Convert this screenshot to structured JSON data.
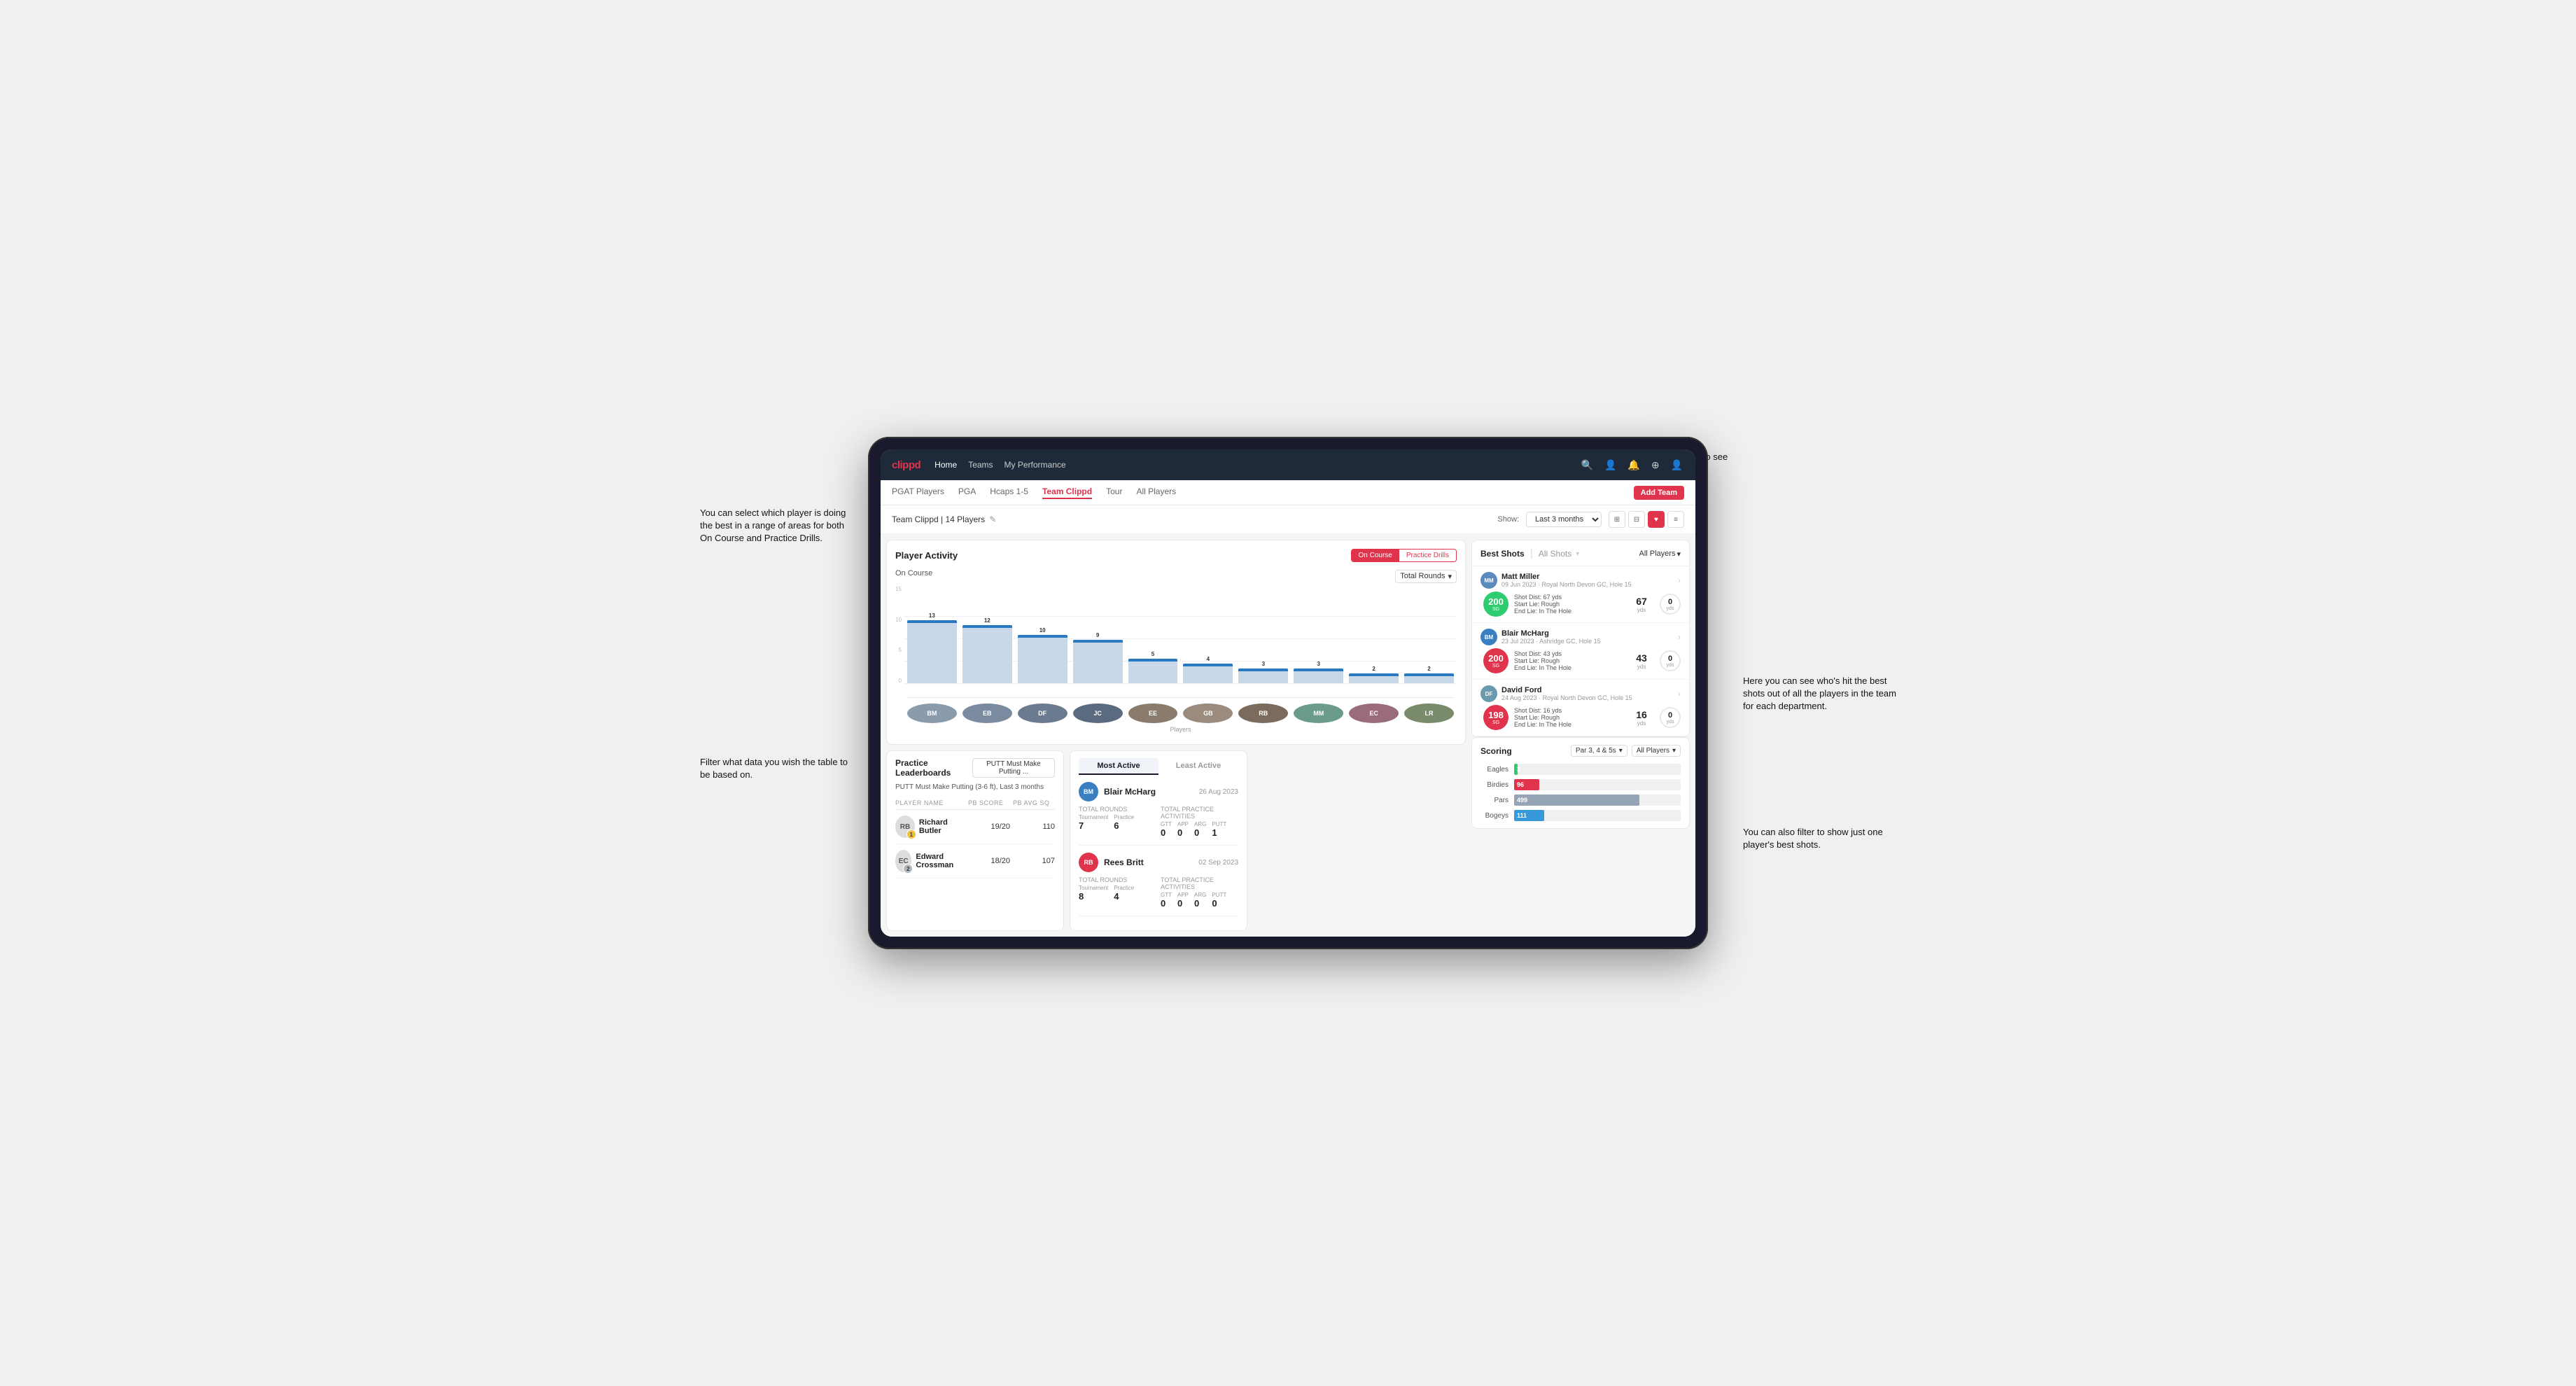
{
  "annotations": {
    "top_right": "Choose the timescale you wish to see the data over.",
    "top_left": "You can select which player is doing the best in a range of areas for both On Course and Practice Drills.",
    "bottom_left": "Filter what data you wish the table to be based on.",
    "middle_right": "Here you can see who's hit the best shots out of all the players in the team for each department.",
    "bottom_right": "You can also filter to show just one player's best shots."
  },
  "nav": {
    "logo": "clippd",
    "links": [
      "Home",
      "Teams",
      "My Performance"
    ],
    "icons": [
      "🔍",
      "👤",
      "🔔",
      "⊕",
      "👤"
    ]
  },
  "sub_nav": {
    "tabs": [
      "PGAT Players",
      "PGA",
      "Hcaps 1-5",
      "Team Clippd",
      "Tour",
      "All Players"
    ],
    "active_tab": "Team Clippd",
    "add_button": "Add Team"
  },
  "team_header": {
    "title": "Team Clippd | 14 Players",
    "edit_icon": "✎",
    "show_label": "Show:",
    "time_select": "Last 3 months",
    "view_modes": [
      "⊞",
      "⊟",
      "♥",
      "≡"
    ]
  },
  "player_activity": {
    "title": "Player Activity",
    "tabs": [
      "On Course",
      "Practice Drills"
    ],
    "active_tab": "On Course",
    "section": "On Course",
    "filter_label": "Total Rounds",
    "x_axis_label": "Players",
    "y_axis_label": "Total Rounds",
    "bars": [
      {
        "name": "B. McHarg",
        "value": 13,
        "color": "#c8d8e8"
      },
      {
        "name": "E. Britt",
        "value": 12,
        "color": "#c8d8e8"
      },
      {
        "name": "D. Ford",
        "value": 10,
        "color": "#c8d8e8"
      },
      {
        "name": "J. Coles",
        "value": 9,
        "color": "#c8d8e8"
      },
      {
        "name": "E. Ebert",
        "value": 5,
        "color": "#c8d8e8"
      },
      {
        "name": "G. Billingham",
        "value": 4,
        "color": "#c8d8e8"
      },
      {
        "name": "R. Butler",
        "value": 3,
        "color": "#c8d8e8"
      },
      {
        "name": "M. Miller",
        "value": 3,
        "color": "#c8d8e8"
      },
      {
        "name": "E. Crossman",
        "value": 2,
        "color": "#c8d8e8"
      },
      {
        "name": "L. Robertson",
        "value": 2,
        "color": "#c8d8e8"
      }
    ],
    "y_axis": [
      "15",
      "10",
      "5",
      "0"
    ]
  },
  "best_shots": {
    "title": "Best Shots",
    "tabs": [
      "Best Shots",
      "All Shots"
    ],
    "active_tab": "Best Shots",
    "filter": "All Players",
    "players": [
      {
        "name": "Matt Miller",
        "date": "09 Jun 2023",
        "course": "Royal North Devon GC",
        "hole": "Hole 15",
        "badge_val": "200",
        "badge_label": "SG",
        "badge_color": "green",
        "shot_dist": "Shot Dist: 67 yds",
        "start_lie": "Start Lie: Rough",
        "end_lie": "End Lie: In The Hole",
        "stat1_val": "67",
        "stat1_unit": "yds",
        "stat2_val": "0",
        "stat2_unit": "yds"
      },
      {
        "name": "Blair McHarg",
        "date": "23 Jul 2023",
        "course": "Ashridge GC",
        "hole": "Hole 15",
        "badge_val": "200",
        "badge_label": "SG",
        "badge_color": "red",
        "shot_dist": "Shot Dist: 43 yds",
        "start_lie": "Start Lie: Rough",
        "end_lie": "End Lie: In The Hole",
        "stat1_val": "43",
        "stat1_unit": "yds",
        "stat2_val": "0",
        "stat2_unit": "yds"
      },
      {
        "name": "David Ford",
        "date": "24 Aug 2023",
        "course": "Royal North Devon GC",
        "hole": "Hole 15",
        "badge_val": "198",
        "badge_label": "SG",
        "badge_color": "red",
        "shot_dist": "Shot Dist: 16 yds",
        "start_lie": "Start Lie: Rough",
        "end_lie": "End Lie: In The Hole",
        "stat1_val": "16",
        "stat1_unit": "yds",
        "stat2_val": "0",
        "stat2_unit": "yds"
      }
    ]
  },
  "practice_leaderboards": {
    "title": "Practice Leaderboards",
    "dropdown": "PUTT Must Make Putting ...",
    "subtitle": "PUTT Must Make Putting (3-6 ft), Last 3 months",
    "columns": [
      "PLAYER NAME",
      "PB SCORE",
      "PB AVG SQ"
    ],
    "rows": [
      {
        "name": "Richard Butler",
        "rank": "1",
        "rank_type": "gold",
        "score": "19/20",
        "avg": "110"
      },
      {
        "name": "Edward Crossman",
        "rank": "2",
        "rank_type": "silver",
        "score": "18/20",
        "avg": "107"
      }
    ]
  },
  "most_active": {
    "tabs": [
      "Most Active",
      "Least Active"
    ],
    "active_tab": "Most Active",
    "players": [
      {
        "name": "Blair McHarg",
        "date": "26 Aug 2023",
        "total_rounds_label": "Total Rounds",
        "tournament_val": "7",
        "practice_val": "6",
        "total_practice_label": "Total Practice Activities",
        "gtt": "0",
        "app": "0",
        "arg": "0",
        "putt": "1"
      },
      {
        "name": "Rees Britt",
        "date": "02 Sep 2023",
        "total_rounds_label": "Total Rounds",
        "tournament_val": "8",
        "practice_val": "4",
        "total_practice_label": "Total Practice Activities",
        "gtt": "0",
        "app": "0",
        "arg": "0",
        "putt": "0"
      }
    ]
  },
  "scoring": {
    "title": "Scoring",
    "filter1": "Par 3, 4 & 5s",
    "filter2": "All Players",
    "bars": [
      {
        "label": "Eagles",
        "value": 3,
        "pct": 2,
        "color": "eagles-fill"
      },
      {
        "label": "Birdies",
        "value": 96,
        "pct": 15,
        "color": "birdies-fill"
      },
      {
        "label": "Pars",
        "value": 499,
        "pct": 75,
        "color": "pars-fill"
      },
      {
        "label": "Bogeys",
        "value": 111,
        "pct": 18,
        "color": "bogeys-fill"
      }
    ]
  },
  "colors": {
    "brand_red": "#e0334c",
    "nav_bg": "#1e2a3a",
    "accent_blue": "#2979c0"
  }
}
